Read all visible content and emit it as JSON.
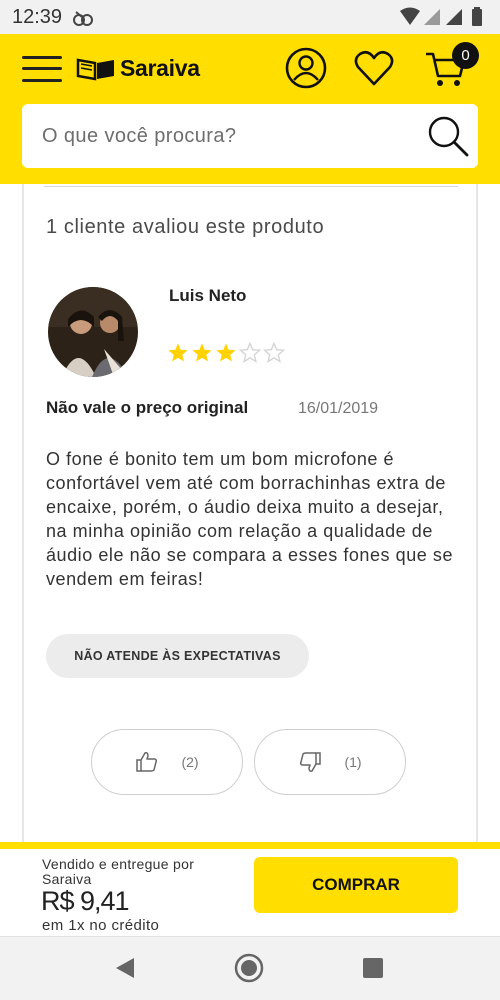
{
  "status_bar": {
    "time": "12:39"
  },
  "header": {
    "brand": "Saraiva",
    "cart_count": "0",
    "search_placeholder": "O que você procura?"
  },
  "review_section": {
    "summary": "1 cliente avaliou este produto",
    "review": {
      "author": "Luis Neto",
      "rating": 3,
      "max_rating": 5,
      "title": "Não vale o preço original",
      "date": "16/01/2019",
      "body": "O fone é bonito tem um bom microfone é confortável vem até com borrachinhas extra de encaixe, porém, o áudio deixa muito a desejar, na minha opinião com relação a qualidade de áudio ele não se compara a esses fones que se vendem em feiras!",
      "tag": "NÃO ATENDE ÀS EXPECTATIVAS",
      "likes": "(2)",
      "dislikes": "(1)"
    }
  },
  "purchase": {
    "sold_by": "Vendido e entregue por Saraiva",
    "price": "R$ 9,41",
    "installments": "em 1x no crédito",
    "buy_label": "COMPRAR"
  },
  "colors": {
    "brand_yellow": "#ffde00",
    "star_filled": "#ffd200",
    "star_empty": "#d4d4d4"
  },
  "icons": [
    "app-notification-icon",
    "wifi-icon",
    "signal-icon",
    "battery-icon",
    "menu-icon",
    "saraiva-logo-icon",
    "user-icon",
    "heart-icon",
    "cart-icon",
    "search-icon",
    "star-icon",
    "thumbs-up-icon",
    "thumbs-down-icon",
    "back-icon",
    "home-icon",
    "recent-apps-icon"
  ]
}
